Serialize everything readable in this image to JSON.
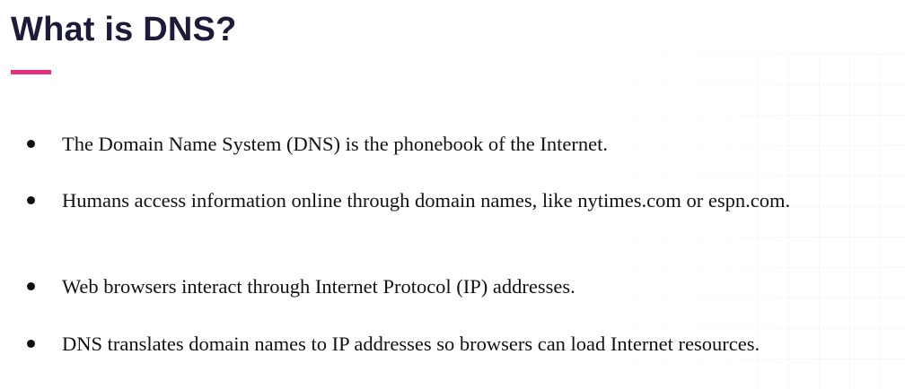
{
  "slide": {
    "title": "What is DNS?",
    "accent_color": "#e8317a",
    "bullets": [
      "The Domain Name System (DNS) is the phonebook of the Internet.",
      "Humans access information online through domain names, like nytimes.com or espn.com.",
      "Web browsers interact through Internet Protocol (IP) addresses.",
      "DNS translates domain names to IP addresses so browsers can load Internet resources."
    ]
  }
}
